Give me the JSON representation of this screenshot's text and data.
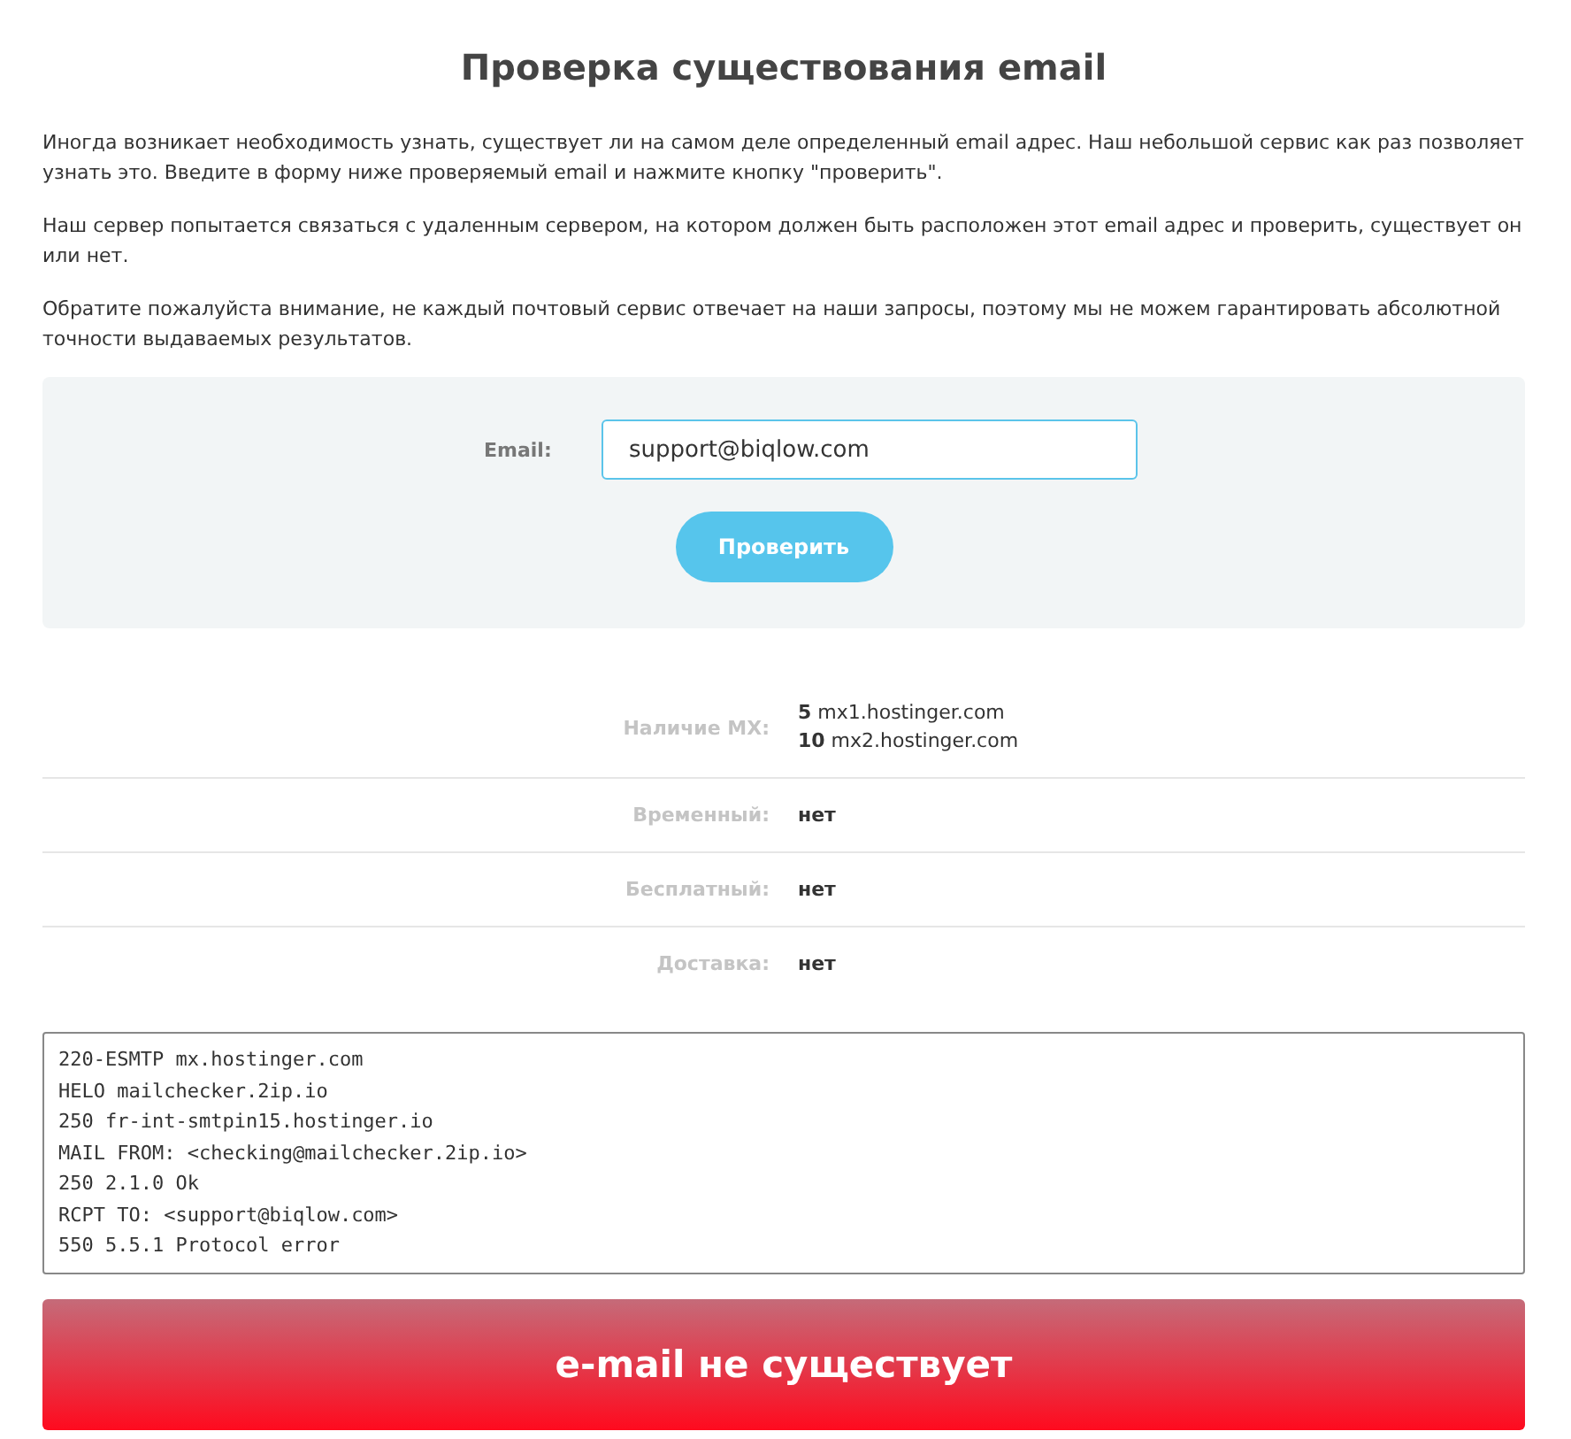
{
  "title": "Проверка существования email",
  "paragraphs": [
    "Иногда возникает необходимость узнать, существует ли на самом деле определенный email адрес. Наш небольшой сервис как раз позволяет узнать это. Введите в форму ниже проверяемый email и нажмите кнопку \"проверить\".",
    "Наш сервер попытается связаться с удаленным сервером, на котором должен быть расположен этот email адрес и проверить, существует он или нет.",
    "Обратите пожалуйста внимание, не каждый почтовый сервис отвечает на наши запросы, поэтому мы не можем гарантировать абсолютной точности выдаваемых результатов."
  ],
  "form": {
    "label": "Email:",
    "value": "support@biqlow.com",
    "button": "Проверить"
  },
  "results": [
    {
      "label": "Наличие MX:",
      "values": [
        "**5** mx1.hostinger.com",
        "**10** mx2.hostinger.com"
      ]
    },
    {
      "label": "Временный:",
      "values": [
        "нет"
      ]
    },
    {
      "label": "Бесплатный:",
      "values": [
        "нет"
      ]
    },
    {
      "label": "Доставка:",
      "values": [
        "нет"
      ]
    }
  ],
  "log": [
    "220-ESMTP mx.hostinger.com",
    "HELO mailchecker.2ip.io",
    "250 fr-int-smtpin15.hostinger.io",
    "MAIL FROM: <checking@mailchecker.2ip.io>",
    "250 2.1.0 Ok",
    "RCPT TO: <support@biqlow.com>",
    "550 5.5.1 Protocol error"
  ],
  "verdict": {
    "kind": "error",
    "text": "e-mail не существует"
  }
}
